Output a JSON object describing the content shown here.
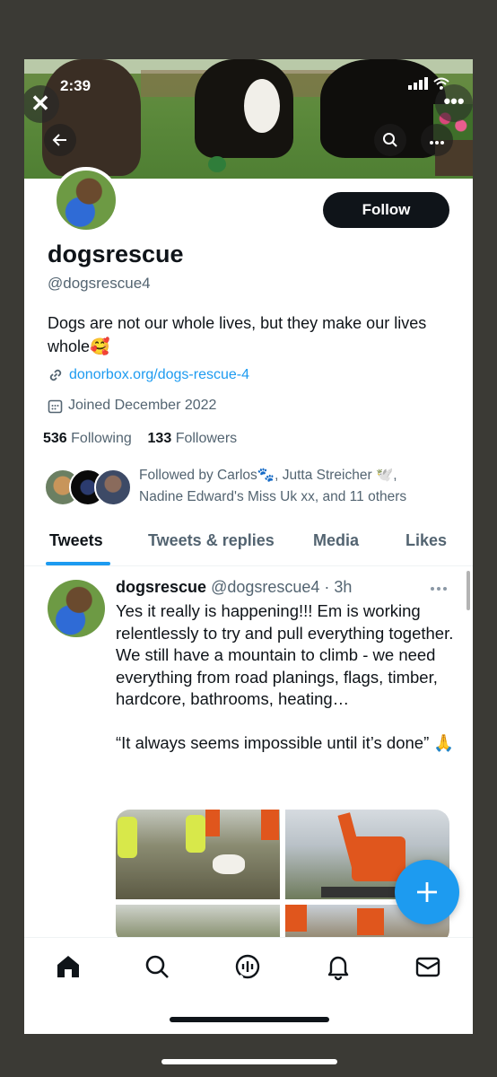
{
  "status_bar": {
    "time": "2:39",
    "close_glyph": "✕",
    "more_glyph": "•••"
  },
  "profile": {
    "follow_label": "Follow",
    "name": "dogsrescue",
    "handle": "@dogsrescue4",
    "bio": "Dogs are not our whole lives, but they make our lives whole🥰",
    "link": "donorbox.org/dogs-rescue-4",
    "joined": "Joined December 2022",
    "following_count": "536",
    "following_label": "Following",
    "followers_count": "133",
    "followers_label": "Followers",
    "followed_by": "Followed by Carlos🐾, Jutta Streicher 🕊️, Nadine Edward's Miss Uk xx, and 11 others"
  },
  "tabs": [
    {
      "label": "Tweets",
      "active": true
    },
    {
      "label": "Tweets & replies",
      "active": false
    },
    {
      "label": "Media",
      "active": false
    },
    {
      "label": "Likes",
      "active": false
    }
  ],
  "tweet": {
    "author": "dogsrescue",
    "handle_time": "@dogsrescue4 · 3h",
    "body": "Yes it really is happening!!! Em is working relentlessly to try and pull everything together.\nWe still have a mountain to climb - we need everything from road planings, flags, timber, hardcore, bathrooms, heating…\n\n“It always seems impossible until it’s done” 🙏"
  },
  "icons": {
    "back": "arrow-left-icon",
    "search": "search-icon",
    "overflow": "more-icon",
    "link": "link-icon",
    "calendar": "calendar-icon",
    "compose": "plus-icon",
    "nav": [
      "home-icon",
      "search-icon",
      "spaces-icon",
      "bell-icon",
      "mail-icon"
    ]
  },
  "colors": {
    "accent": "#1d9bf0",
    "text": "#0f1419",
    "muted": "#536471",
    "button_dark": "#0f1419"
  }
}
